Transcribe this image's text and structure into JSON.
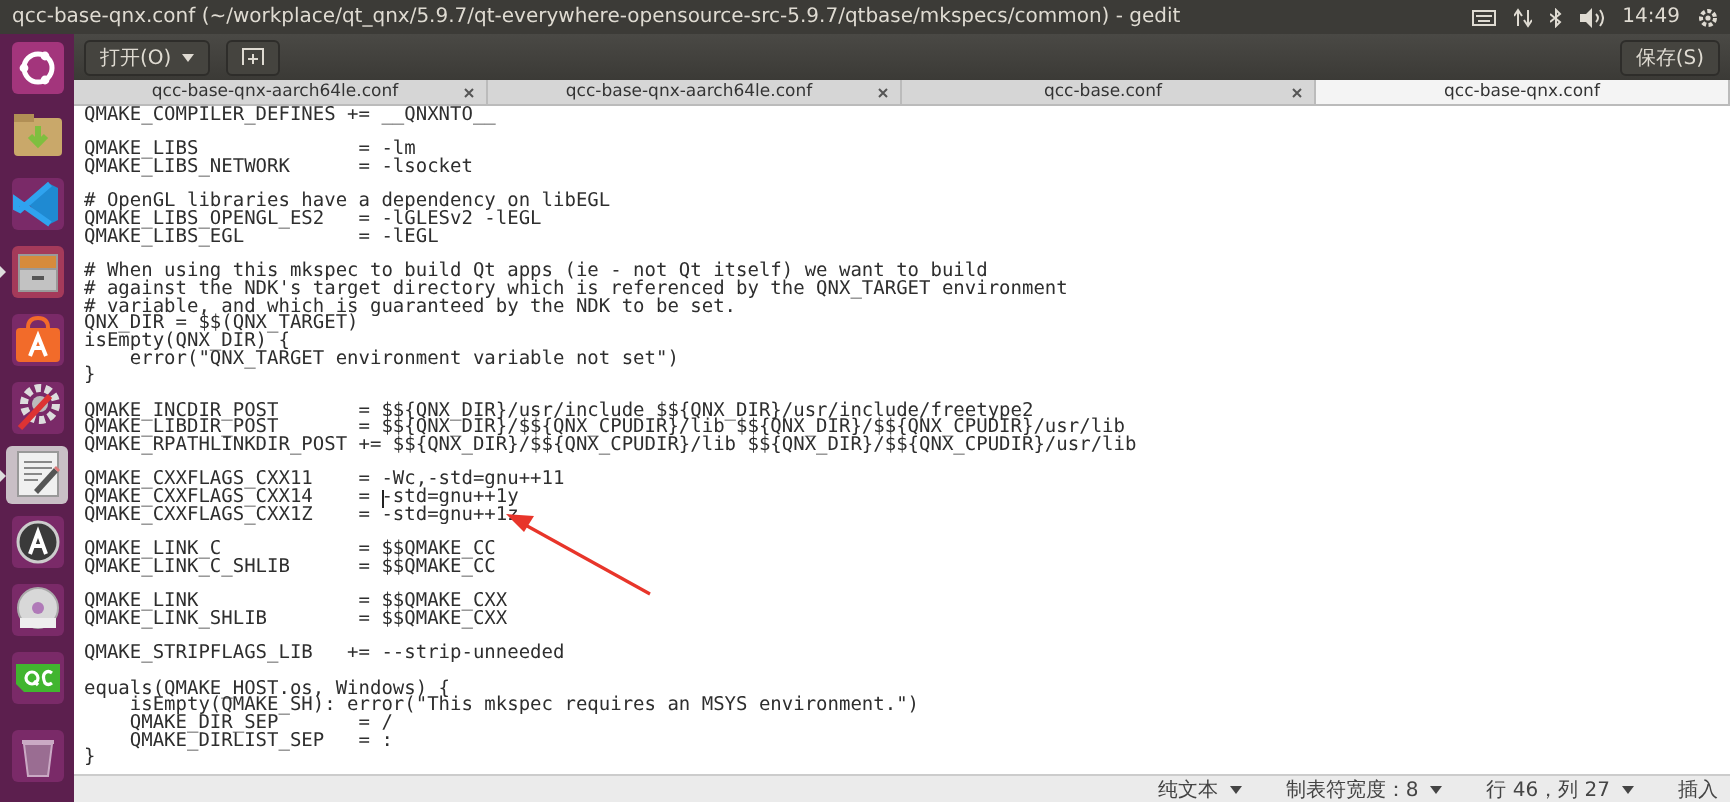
{
  "top_panel": {
    "title": "qcc-base-qnx.conf (~/workplace/qt_qnx/5.9.7/qt-everywhere-opensource-src-5.9.7/qtbase/mkspecs/common) - gedit",
    "clock": "14:49"
  },
  "launcher": [
    {
      "kind": "ubuntu",
      "selected": false,
      "running": false
    },
    {
      "kind": "files",
      "selected": false,
      "running": false
    },
    {
      "kind": "vscode",
      "selected": false,
      "running": false
    },
    {
      "kind": "cabinet",
      "selected": false,
      "running": true
    },
    {
      "kind": "store",
      "selected": false,
      "running": false
    },
    {
      "kind": "settings",
      "selected": false,
      "running": false
    },
    {
      "kind": "editor",
      "selected": true,
      "running": true
    },
    {
      "kind": "updater",
      "selected": false,
      "running": false
    },
    {
      "kind": "dvd",
      "selected": false,
      "running": false
    },
    {
      "kind": "qc",
      "selected": false,
      "running": false
    },
    {
      "kind": "trash",
      "selected": false,
      "running": false
    }
  ],
  "header_bar": {
    "open_button": "打开(O)",
    "save_button": "保存(S)"
  },
  "tabs": [
    {
      "label": "qcc-base-qnx-aarch64le.conf",
      "selected": false
    },
    {
      "label": "qcc-base-qnx-aarch64le.conf",
      "selected": false
    },
    {
      "label": "qcc-base.conf",
      "selected": false
    },
    {
      "label": "qcc-base-qnx.conf",
      "selected": true
    }
  ],
  "editor": {
    "lines": [
      {
        "text": "QMAKE_COMPILER_DEFINES += __QNXNTO__",
        "cursor": false
      },
      {
        "cursor": false
      },
      {
        "text": "QMAKE_LIBS              = -lm",
        "cursor": false
      },
      {
        "text": "QMAKE_LIBS_NETWORK      = -lsocket",
        "cursor": false
      },
      {
        "cursor": false
      },
      {
        "text": "# OpenGL libraries have a dependency on libEGL",
        "cursor": false
      },
      {
        "text": "QMAKE_LIBS_OPENGL_ES2   = -lGLESv2 -lEGL",
        "cursor": false
      },
      {
        "text": "QMAKE_LIBS_EGL          = -lEGL",
        "cursor": false
      },
      {
        "cursor": false
      },
      {
        "text": "# When using this mkspec to build Qt apps (ie - not Qt itself) we want to build",
        "cursor": false
      },
      {
        "text": "# against the NDK's target directory which is referenced by the QNX_TARGET environment",
        "cursor": false
      },
      {
        "text": "# variable, and which is guaranteed by the NDK to be set.",
        "cursor": false
      },
      {
        "text": "QNX_DIR = $$(QNX_TARGET)",
        "cursor": false
      },
      {
        "text": "isEmpty(QNX_DIR) {",
        "cursor": false
      },
      {
        "text": "    error(\"QNX_TARGET environment variable not set\")",
        "cursor": false
      },
      {
        "text": "}",
        "cursor": false
      },
      {
        "cursor": false
      },
      {
        "text": "QMAKE_INCDIR_POST       = $${QNX_DIR}/usr/include $${QNX_DIR}/usr/include/freetype2",
        "cursor": false
      },
      {
        "text": "QMAKE_LIBDIR_POST       = $${QNX_DIR}/$${QNX_CPUDIR}/lib $${QNX_DIR}/$${QNX_CPUDIR}/usr/lib",
        "cursor": false
      },
      {
        "text": "QMAKE_RPATHLINKDIR_POST += $${QNX_DIR}/$${QNX_CPUDIR}/lib $${QNX_DIR}/$${QNX_CPUDIR}/usr/lib",
        "cursor": false
      },
      {
        "cursor": false
      },
      {
        "text": "QMAKE_CXXFLAGS_CXX11    = -Wc,-std=gnu++11",
        "cursor": false
      },
      {
        "text": "QMAKE_CXXFLAGS_CXX14    = -std=gnu++1y",
        "cursor": true
      },
      {
        "text": "QMAKE_CXXFLAGS_CXX1Z    = -std=gnu++1z",
        "cursor": false
      },
      {
        "cursor": false
      },
      {
        "text": "QMAKE_LINK_C            = $$QMAKE_CC",
        "cursor": false
      },
      {
        "text": "QMAKE_LINK_C_SHLIB      = $$QMAKE_CC",
        "cursor": false
      },
      {
        "cursor": false
      },
      {
        "text": "QMAKE_LINK              = $$QMAKE_CXX",
        "cursor": false
      },
      {
        "text": "QMAKE_LINK_SHLIB        = $$QMAKE_CXX",
        "cursor": false
      },
      {
        "cursor": false
      },
      {
        "text": "QMAKE_STRIPFLAGS_LIB   += --strip-unneeded",
        "cursor": false
      },
      {
        "cursor": false
      },
      {
        "text": "equals(QMAKE_HOST.os, Windows) {",
        "cursor": false
      },
      {
        "text": "    isEmpty(QMAKE_SH): error(\"This mkspec requires an MSYS environment.\")",
        "cursor": false
      },
      {
        "text": "    QMAKE_DIR_SEP       = /",
        "cursor": false
      },
      {
        "text": "    QMAKE_DIRLIST_SEP   = :",
        "cursor": false
      },
      {
        "text": "}",
        "cursor": false
      }
    ],
    "annotations": [
      {
        "kind": "arrow"
      }
    ]
  },
  "status_bar": [
    {
      "text": "纯文本",
      "dropdown": true
    },
    {
      "text": "制表符宽度：8",
      "dropdown": true
    },
    {
      "text": "行 46，列 27",
      "dropdown": true
    },
    {
      "text": "插入",
      "dropdown": false
    }
  ]
}
